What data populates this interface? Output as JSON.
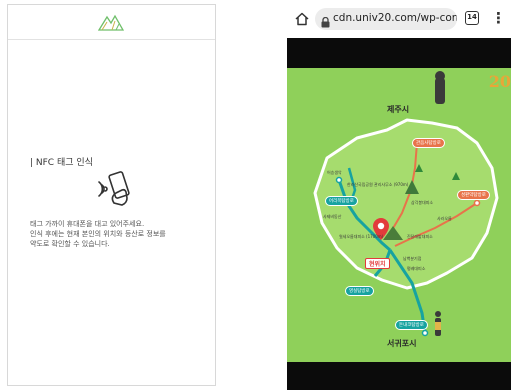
{
  "left_screen": {
    "logo_icon": "mountain-logo-icon",
    "nfc_title": "| NFC 태그 인식",
    "nfc_icon": "nfc-phone-tap-icon",
    "description": [
      "태그 가까이 휴대폰을 대고 있어주세요.",
      "인식 후에는 현재 본인의 위치와 등산로 정보를",
      "약도로 확인할 수 있습니다."
    ]
  },
  "right_screen": {
    "browser": {
      "home_icon": "home-icon",
      "lock_icon": "lock-icon",
      "url": "cdn.univ20.com/wp-con",
      "tabs_count": "14",
      "menu_icon": "more-vert-icon"
    },
    "map": {
      "north_city": "제주시",
      "south_city": "서귀포시",
      "current_location": "현위치",
      "brand": "20",
      "routes": [
        "관음사탐방로",
        "성판악탐방로",
        "어리목탐방로",
        "영실탐방로",
        "돈내코탐방로"
      ],
      "pois": [
        "어승생악",
        "한라산국립공원 관리사무소 (970m)",
        "사제비동산",
        "윗세오름대피소 (1700m)",
        "삼각봉대피소",
        "사라오름",
        "진달래밭대피소",
        "남벽분기점",
        "평궤대피소"
      ],
      "colors": {
        "background": "#8fd05a",
        "trail_primary": "#17a3a0",
        "trail_secondary": "#e8734a",
        "location_marker": "#e23b3b"
      }
    }
  }
}
